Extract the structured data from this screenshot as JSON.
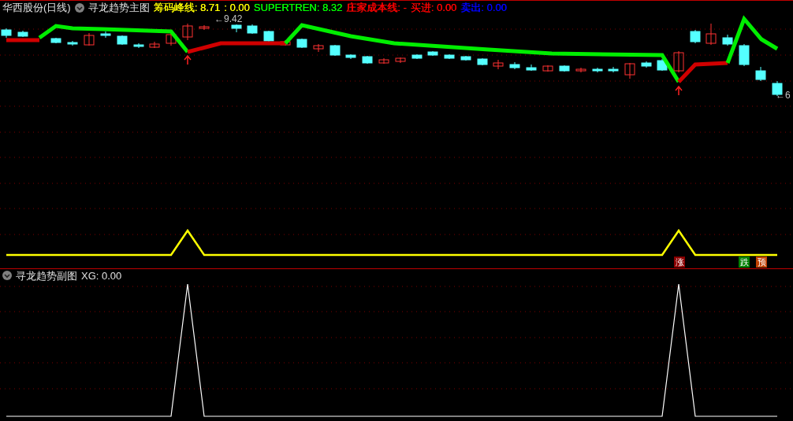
{
  "main_panel": {
    "stock": "华西股份(日线)",
    "indicator": "寻龙趋势主图",
    "readings": [
      {
        "text": "筹码峰线: 8.71",
        "color": "#ffff00"
      },
      {
        "text": ": 0.00",
        "color": "#ffff00"
      },
      {
        "text": "SUPERTREN: 8.32",
        "color": "#00ff00"
      },
      {
        "text": "庄家成本线: -",
        "color": "#ff0000"
      },
      {
        "text": "买进: 0.00",
        "color": "#ff0000"
      },
      {
        "text": "卖出: 0.00",
        "color": "#0000ff"
      }
    ],
    "price_labels": [
      {
        "text": "←9.42"
      },
      {
        "text": "←6"
      }
    ],
    "signal_markers": [
      {
        "text": "涨",
        "color": "#8b0000"
      },
      {
        "text": "跌",
        "color": "#008000"
      },
      {
        "text": "预",
        "color": "#c04000"
      }
    ]
  },
  "sub_panel": {
    "indicator": "寻龙趋势副图",
    "reading": "XG: 0.00"
  }
}
